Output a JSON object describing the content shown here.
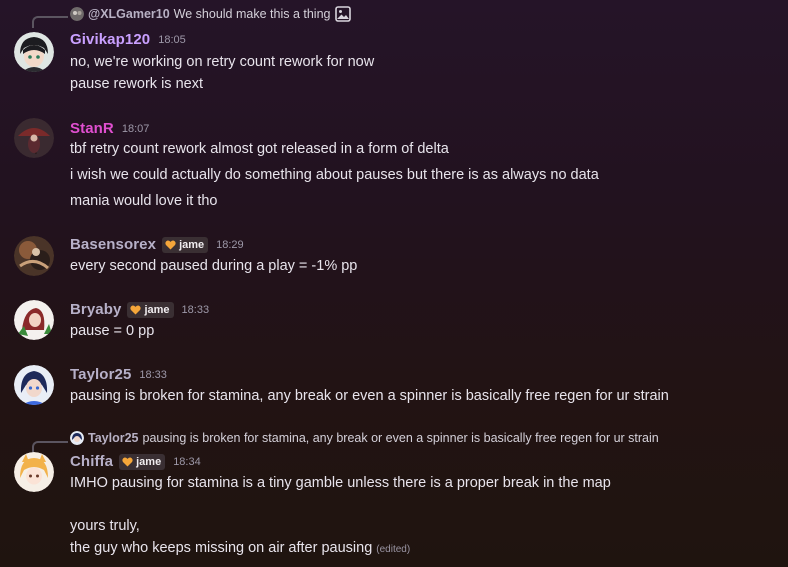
{
  "messages": [
    {
      "reply": {
        "name": "@XLGamer10",
        "text": "We should make this a thing",
        "has_image_icon": true
      },
      "username": "Givikap120",
      "name_color": "#c9a0ff",
      "time": "18:05",
      "lines": [
        "no, we're working on retry count rework for now",
        "pause rework is next"
      ]
    },
    {
      "username": "StanR",
      "name_color": "#e04fd0",
      "time": "18:07",
      "lines": [
        "tbf retry count rework almost got released in a form of delta",
        "i wish we could actually do something about pauses but there is as always no data",
        "mania would love it tho"
      ]
    },
    {
      "username": "Basensorex",
      "name_color": "#b7b0c8",
      "tag": "jame",
      "time": "18:29",
      "lines": [
        "every second paused during a play = -1% pp"
      ]
    },
    {
      "username": "Bryaby",
      "name_color": "#b7b0c8",
      "tag": "jame",
      "time": "18:33",
      "lines": [
        "pause = 0 pp"
      ]
    },
    {
      "username": "Taylor25",
      "name_color": "#b7b0c8",
      "time": "18:33",
      "lines": [
        "pausing is broken for stamina, any break or even a spinner is basically free regen for ur strain"
      ]
    },
    {
      "reply": {
        "name": "Taylor25",
        "text": "pausing is broken for stamina, any break or even a spinner is basically free regen for ur strain",
        "has_image_icon": false
      },
      "username": "Chiffa",
      "name_color": "#b7b0c8",
      "tag": "jame",
      "time": "18:34",
      "lines": [
        "IMHO pausing for stamina is a tiny gamble unless there is a proper break in the map",
        "",
        "yours truly,",
        "the guy who keeps missing on air after pausing"
      ],
      "edited": "(edited)"
    }
  ]
}
